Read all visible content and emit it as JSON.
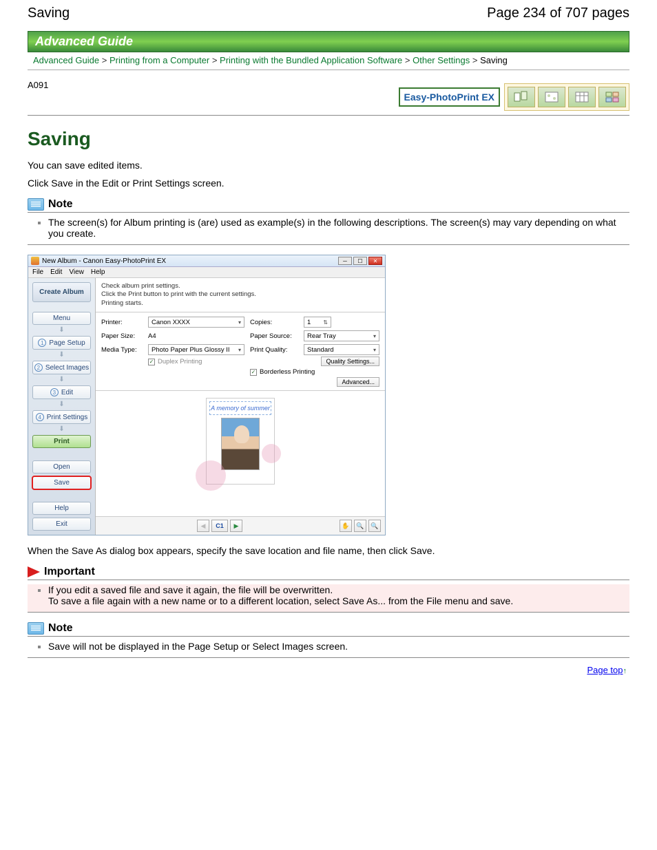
{
  "header": {
    "title": "Saving",
    "page_indicator": "Page 234 of 707 pages"
  },
  "banner": "Advanced Guide",
  "breadcrumb": {
    "items": [
      "Advanced Guide",
      "Printing from a Computer",
      "Printing with the Bundled Application Software",
      "Other Settings",
      "Saving"
    ],
    "sep": ">"
  },
  "page_code": "A091",
  "product_label": "Easy-PhotoPrint EX",
  "title": "Saving",
  "intro1": "You can save edited items.",
  "intro2": "Click Save in the Edit or Print Settings screen.",
  "note1_heading": "Note",
  "note1_text": "The screen(s) for Album printing is (are) used as example(s) in the following descriptions. The screen(s) may vary depending on what you create.",
  "after_shot": "When the Save As dialog box appears, specify the save location and file name, then click Save.",
  "important_heading": "Important",
  "important_text": "If you edit a saved file and save it again, the file will be overwritten.\nTo save a file again with a new name or to a different location, select Save As... from the File menu and save.",
  "note2_heading": "Note",
  "note2_text": "Save will not be displayed in the Page Setup or Select Images screen.",
  "page_top": "Page top",
  "app": {
    "title": "New Album - Canon Easy-PhotoPrint EX",
    "menubar": [
      "File",
      "Edit",
      "View",
      "Help"
    ],
    "sidebar": {
      "title": "Create Album",
      "menu": "Menu",
      "steps": {
        "s1": "Page Setup",
        "s2": "Select Images",
        "s3": "Edit",
        "s4": "Print Settings"
      },
      "print": "Print",
      "open": "Open",
      "save": "Save",
      "help": "Help",
      "exit": "Exit"
    },
    "instruct": {
      "l1": "Check album print settings.",
      "l2": "Click the Print button to print with the current settings.",
      "l3": "Printing starts."
    },
    "settings": {
      "printer_lbl": "Printer:",
      "printer_val": "Canon XXXX",
      "copies_lbl": "Copies:",
      "copies_val": "1",
      "papersize_lbl": "Paper Size:",
      "papersize_val": "A4",
      "papersource_lbl": "Paper Source:",
      "papersource_val": "Rear Tray",
      "mediatype_lbl": "Media Type:",
      "mediatype_val": "Photo Paper Plus Glossy II",
      "quality_lbl": "Print Quality:",
      "quality_val": "Standard",
      "duplex": "Duplex Printing",
      "quality_btn": "Quality Settings...",
      "borderless": "Borderless Printing",
      "advanced_btn": "Advanced..."
    },
    "album_caption": "A memory of summer",
    "toolbar": {
      "page": "C1"
    }
  }
}
